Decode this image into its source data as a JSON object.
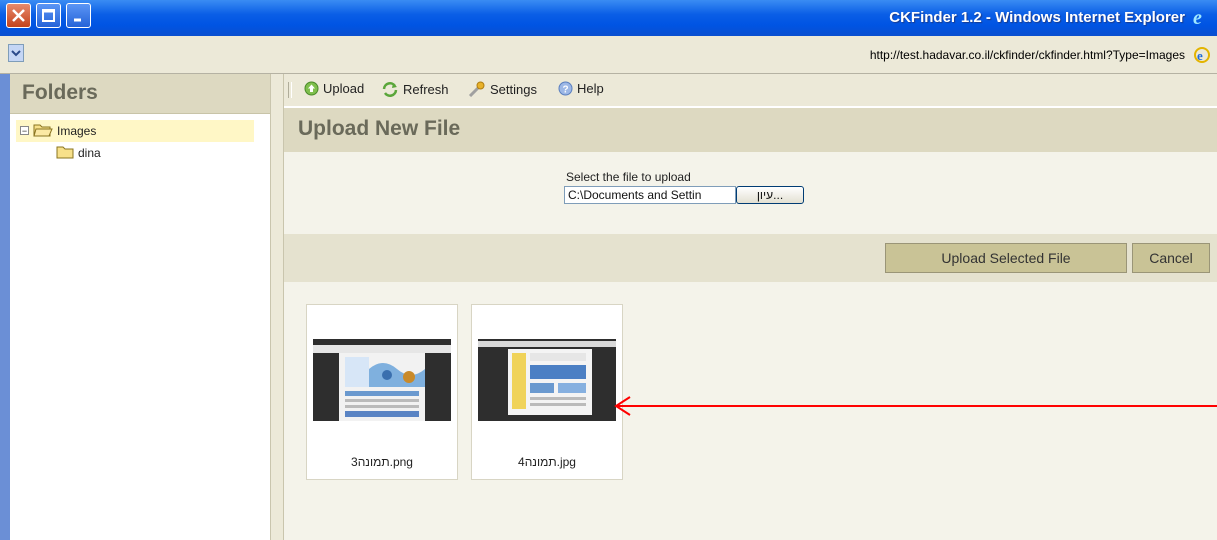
{
  "window": {
    "title": "CKFinder 1.2 - Windows Internet Explorer",
    "url": "http://test.hadavar.co.il/ckfinder/ckfinder.html?Type=Images"
  },
  "folders": {
    "title": "Folders",
    "tree": [
      {
        "label": "Images",
        "selected": true,
        "toggle": "−"
      },
      {
        "label": "dina",
        "selected": false
      }
    ]
  },
  "toolbar": {
    "upload": "Upload",
    "refresh": "Refresh",
    "settings": "Settings",
    "help": "Help"
  },
  "upload": {
    "title": "Upload New File",
    "select_label": "Select the file to upload",
    "file_value": "C:\\Documents and Settin",
    "browse_label": "עיון...",
    "upload_button": "Upload Selected File",
    "cancel_button": "Cancel"
  },
  "files": [
    {
      "name": "3תמונה.png"
    },
    {
      "name": "4תמונה.jpg"
    }
  ],
  "colors": {
    "annotation_arrow": "#ff0000",
    "panel_header": "#ddd9c1",
    "xp_blue": "#0054e3"
  }
}
